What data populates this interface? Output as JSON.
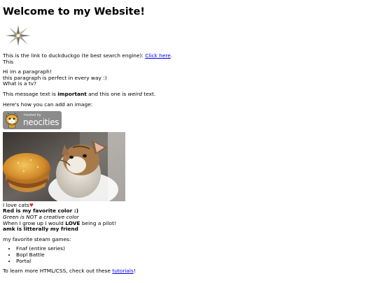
{
  "page": {
    "title": "Welcome to my Website!",
    "sparkle_icon": "sparkle-icon",
    "link_line": {
      "prefix": "This is the link to duckduckgo (te best search engine): ",
      "link_text": "Click here",
      "suffix": "."
    },
    "this_line": "This",
    "paragraph": {
      "line1": "Hi im a paragraph!",
      "line2": "this paragraph is perfect in every way :)",
      "line3": "What is a tv?"
    },
    "message_line": {
      "part1": "This message text is ",
      "important": "important",
      "part2": " and this one is ",
      "weird": "weird",
      "part3": " text."
    },
    "image_intro": "Here's how you can add an image:",
    "neocities_badge": {
      "small_text": "hosted by",
      "big_text": "neocities"
    },
    "cat_image_icon": "cat-eating-burger-photo",
    "love_cats": "I love cats",
    "heart": "♥",
    "red_favorite": "Red is my favorite color :)",
    "green_line": "Green is NOT a creative color",
    "pilot_line": {
      "part1": "When I grow up I would ",
      "love": "LOVE",
      "part2": " being a pilot!"
    },
    "amk_line": "amk is litterally my friend",
    "games_intro": "my favorite steam games:",
    "games": [
      "Fnaf (entire series)",
      "Bopl Battle",
      "Portal"
    ],
    "learn_line": {
      "prefix": "To learn more HTML/CSS, check out these ",
      "link_text": "tutorials",
      "suffix": "!"
    }
  },
  "colors": {
    "link": "#0000ee",
    "heart": "#e0302a",
    "badge_bg": "#8b8b8b"
  }
}
